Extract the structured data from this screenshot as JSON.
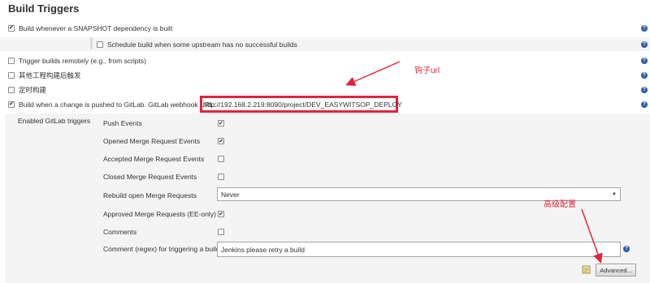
{
  "title": "Build Triggers",
  "triggers": [
    {
      "label": "Build whenever a SNAPSHOT dependency is built",
      "checked": true
    },
    {
      "label": "Schedule build when some upstream has no successful builds",
      "checked": false
    },
    {
      "label": "Trigger builds remotely (e.g., from scripts)",
      "checked": false
    },
    {
      "label": "其他工程构建后触发",
      "checked": false
    },
    {
      "label": "定时构建",
      "checked": false
    },
    {
      "label": "Build when a change is pushed to GitLab. GitLab webhook URL:",
      "checked": true
    }
  ],
  "webhook_url": "http://192.168.2.219:8090/project/DEV_EASYWITSOP_DEPLOY",
  "gitlab": {
    "heading": "Enabled GitLab triggers",
    "options": [
      {
        "label": "Push Events",
        "checked": true
      },
      {
        "label": "Opened Merge Request Events",
        "checked": true
      },
      {
        "label": "Accepted Merge Request Events",
        "checked": false
      },
      {
        "label": "Closed Merge Request Events",
        "checked": false
      },
      {
        "label": "Rebuild open Merge Requests",
        "value": "Never"
      },
      {
        "label": "Approved Merge Requests (EE-only)",
        "checked": true
      },
      {
        "label": "Comments",
        "checked": false
      },
      {
        "label": "Comment (regex) for triggering a build",
        "value": "Jenkins please retry a build"
      }
    ],
    "advanced_label": "Advanced..."
  },
  "annotations": {
    "hook_url": "钩子url",
    "advanced_config": "高级配置"
  },
  "colors": {
    "annotation_red": "#e0243c",
    "help_blue": "#2d5da8"
  }
}
